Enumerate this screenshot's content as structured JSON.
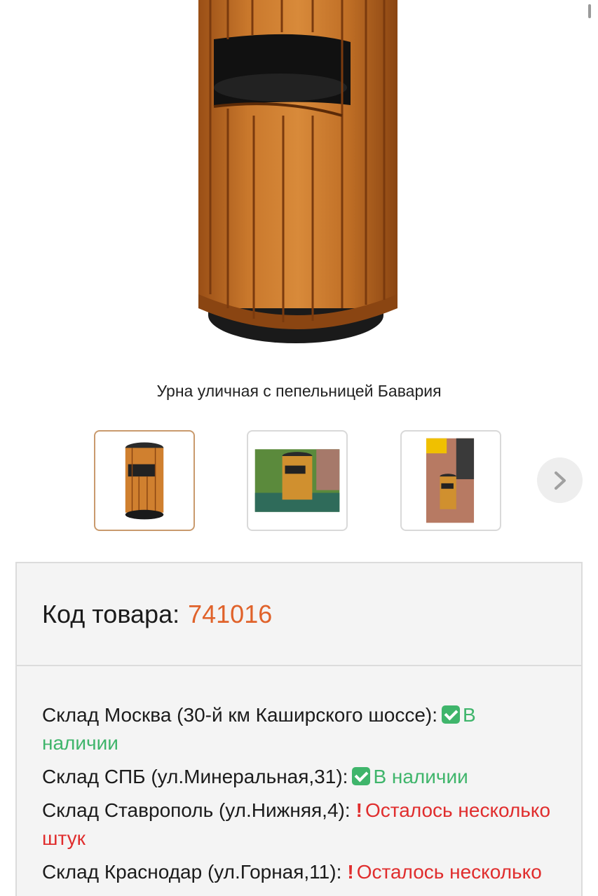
{
  "product": {
    "caption": "Урна уличная с пепельницей Бавария",
    "code_label": "Код товара:",
    "code_value": "741016"
  },
  "gallery": {
    "thumbnails": [
      {
        "name": "urn-studio-photo",
        "active": true
      },
      {
        "name": "urn-lawn-photo",
        "active": false
      },
      {
        "name": "urn-street-photo",
        "active": false
      }
    ],
    "next_icon": "chevron-right-icon"
  },
  "stock": [
    {
      "warehouse": "Склад Москва (30-й км Каширского шоссе):",
      "status": "В наличии",
      "kind": "ok",
      "icon": "check-icon"
    },
    {
      "warehouse": "Склад СПБ (ул.Минеральная,31):",
      "status": "В наличии",
      "kind": "ok",
      "icon": "check-icon"
    },
    {
      "warehouse": "Склад Ставрополь (ул.Нижняя,4):",
      "status": "Осталось несколько штук",
      "kind": "low",
      "icon": "exclamation-icon"
    },
    {
      "warehouse": "Склад Краснодар (ул.Горная,11):",
      "status": "Осталось несколько штук",
      "kind": "low",
      "icon": "exclamation-icon"
    }
  ],
  "colors": {
    "accent": "#e0622a",
    "in_stock": "#3fb56b",
    "low_stock": "#e02d2d"
  }
}
